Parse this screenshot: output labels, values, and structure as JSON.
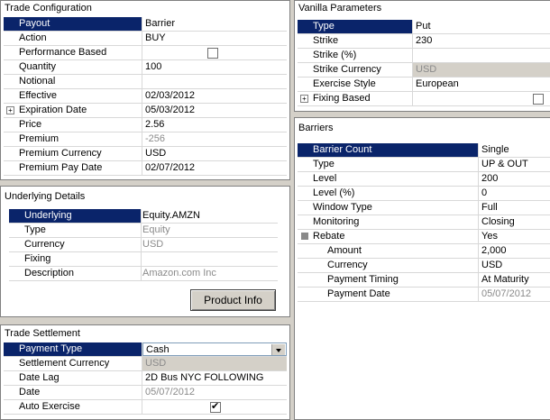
{
  "trade_config": {
    "title": "Trade Configuration",
    "rows": [
      {
        "label": "Payout",
        "value": "Barrier"
      },
      {
        "label": "Action",
        "value": "BUY"
      },
      {
        "label": "Performance Based",
        "value": ""
      },
      {
        "label": "Quantity",
        "value": "100"
      },
      {
        "label": "Notional",
        "value": ""
      },
      {
        "label": "Effective",
        "value": "02/03/2012"
      },
      {
        "label": "Expiration Date",
        "value": "05/03/2012"
      },
      {
        "label": "Price",
        "value": "2.56"
      },
      {
        "label": "Premium",
        "value": "-256"
      },
      {
        "label": "Premium Currency",
        "value": "USD"
      },
      {
        "label": "Premium Pay Date",
        "value": "02/07/2012"
      }
    ]
  },
  "underlying": {
    "title": "Underlying Details",
    "rows": [
      {
        "label": "Underlying",
        "value": "Equity.AMZN"
      },
      {
        "label": "Type",
        "value": "Equity"
      },
      {
        "label": "Currency",
        "value": "USD"
      },
      {
        "label": "Fixing",
        "value": ""
      },
      {
        "label": "Description",
        "value": "Amazon.com Inc"
      }
    ],
    "button_label": "Product Info"
  },
  "settlement": {
    "title": "Trade Settlement",
    "rows": [
      {
        "label": "Payment Type",
        "value": "Cash"
      },
      {
        "label": "Settlement Currency",
        "value": "USD"
      },
      {
        "label": "Date Lag",
        "value": "2D Bus NYC FOLLOWING"
      },
      {
        "label": "Date",
        "value": "05/07/2012"
      },
      {
        "label": "Auto Exercise",
        "value": ""
      }
    ]
  },
  "vanilla": {
    "title": "Vanilla Parameters",
    "rows": [
      {
        "label": "Type",
        "value": "Put"
      },
      {
        "label": "Strike",
        "value": "230"
      },
      {
        "label": "Strike (%)",
        "value": ""
      },
      {
        "label": "Strike Currency",
        "value": "USD"
      },
      {
        "label": "Exercise Style",
        "value": "European"
      },
      {
        "label": "Fixing Based",
        "value": ""
      }
    ]
  },
  "barriers": {
    "title": "Barriers",
    "rows": [
      {
        "label": "Barrier Count",
        "value": "Single"
      },
      {
        "label": "Type",
        "value": "UP & OUT"
      },
      {
        "label": "Level",
        "value": "200"
      },
      {
        "label": "Level (%)",
        "value": "0"
      },
      {
        "label": "Window Type",
        "value": "Full"
      },
      {
        "label": "Monitoring",
        "value": "Closing"
      },
      {
        "label": "Rebate",
        "value": "Yes"
      },
      {
        "label": "Amount",
        "value": "2,000"
      },
      {
        "label": "Currency",
        "value": "USD"
      },
      {
        "label": "Payment Timing",
        "value": "At Maturity"
      },
      {
        "label": "Payment Date",
        "value": "05/07/2012"
      }
    ]
  }
}
